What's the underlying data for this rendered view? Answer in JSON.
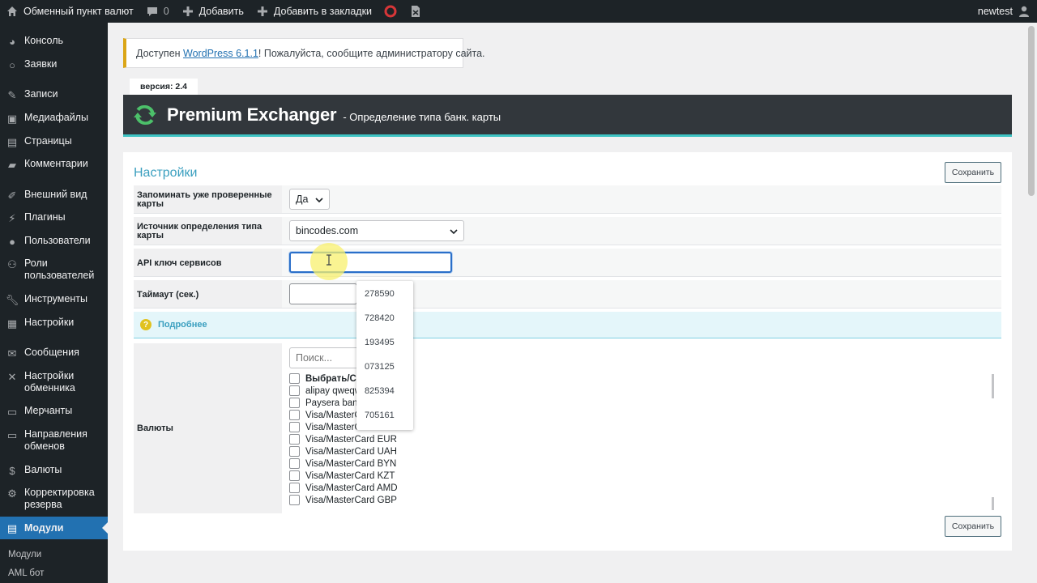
{
  "adminbar": {
    "site_name": "Обменный пункт валют",
    "comments_count": "0",
    "add_label": "Добавить",
    "bookmark_label": "Добавить в закладки",
    "user": "newtest"
  },
  "sidebar": {
    "items": [
      {
        "label": "Консоль",
        "icon": "dashboard-icon"
      },
      {
        "label": "Заявки",
        "icon": "circle-icon"
      },
      {
        "label": "Записи",
        "icon": "pin-icon"
      },
      {
        "label": "Медиафайлы",
        "icon": "media-icon"
      },
      {
        "label": "Страницы",
        "icon": "page-icon"
      },
      {
        "label": "Комментарии",
        "icon": "comment-icon"
      },
      {
        "label": "Внешний вид",
        "icon": "brush-icon"
      },
      {
        "label": "Плагины",
        "icon": "plugin-icon"
      },
      {
        "label": "Пользователи",
        "icon": "user-icon"
      },
      {
        "label": "Роли пользователей",
        "icon": "roles-icon"
      },
      {
        "label": "Инструменты",
        "icon": "wrench-icon"
      },
      {
        "label": "Настройки",
        "icon": "settings-icon"
      },
      {
        "label": "Сообщения",
        "icon": "mail-icon"
      },
      {
        "label": "Настройки обменника",
        "icon": "tools-icon"
      },
      {
        "label": "Мерчанты",
        "icon": "merchant-icon"
      },
      {
        "label": "Направления обменов",
        "icon": "directions-icon"
      },
      {
        "label": "Валюты",
        "icon": "dollar-icon"
      },
      {
        "label": "Корректировка резерва",
        "icon": "gear-icon"
      },
      {
        "label": "Модули",
        "icon": "modules-icon"
      }
    ],
    "sub_items": [
      "Модули",
      "AML бот"
    ]
  },
  "notice": {
    "prefix": "Доступен ",
    "link": "WordPress 6.1.1",
    "suffix": "! Пожалуйста, сообщите администратору сайта."
  },
  "version": "версия: 2.4",
  "header": {
    "title": "Premium Exchanger",
    "subtitle": "- Определение типа банк. карты"
  },
  "settings": {
    "title": "Настройки",
    "save_label": "Сохранить",
    "remember_label": "Запоминать уже проверенные карты",
    "remember_value": "Да",
    "source_label": "Источник определения типа карты",
    "source_value": "bincodes.com",
    "api_label": "API ключ сервисов",
    "api_value": "",
    "timeout_label": "Таймаут (сек.)",
    "timeout_value": "",
    "more_label": "Подробнее",
    "currencies_label": "Валюты",
    "search_placeholder": "Поиск...",
    "currencies": [
      "Выбрать/Сня",
      "alipay qweqw",
      "Paysera bank",
      "Visa/MasterC",
      "Visa/MasterC",
      "Visa/MasterCard EUR",
      "Visa/MasterCard UAH",
      "Visa/MasterCard BYN",
      "Visa/MasterCard KZT",
      "Visa/MasterCard AMD",
      "Visa/MasterCard GBP"
    ]
  },
  "autocomplete": [
    "278590",
    "728420",
    "193495",
    "073125",
    "825394",
    "705161"
  ]
}
